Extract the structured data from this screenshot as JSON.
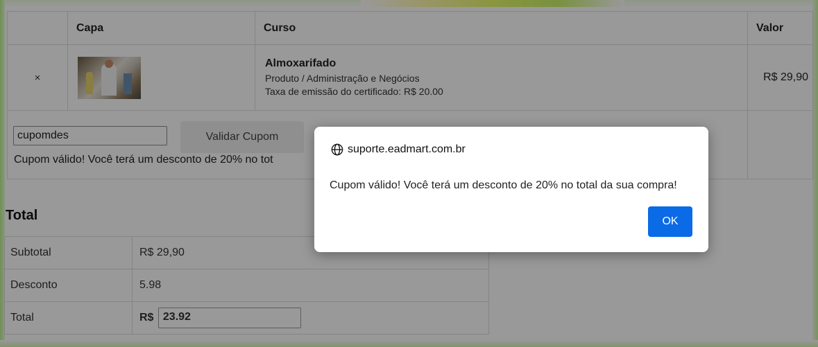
{
  "cart": {
    "headers": {
      "remove": "",
      "cover": "Capa",
      "course": "Curso",
      "value": "Valor"
    },
    "items": [
      {
        "remove_icon": "×",
        "thumbnail_alt": "course-thumbnail",
        "title": "Almoxarifado",
        "category": "Produto / Administração e Negócios",
        "certificate_fee": "Taxa de emissão do certificado: R$ 20.00",
        "price": "R$ 29,90"
      }
    ]
  },
  "coupon": {
    "input_value": "cupomdes",
    "button_label": "Validar Cupom",
    "message": "Cupom válido! Você terá um desconto de 20% no tot"
  },
  "totals": {
    "title": "Total",
    "rows": [
      {
        "label": "Subtotal",
        "value": "R$ 29,90"
      },
      {
        "label": "Desconto",
        "value": "5.98"
      }
    ],
    "total_label": "Total",
    "total_currency": "R$",
    "total_value": "23.92"
  },
  "dialog": {
    "origin": "suporte.eadmart.com.br",
    "message": "Cupom válido! Você terá um desconto de 20% no total da sua compra!",
    "ok_label": "OK",
    "icon": "globe-icon",
    "ok_color": "#0b6ae6"
  }
}
